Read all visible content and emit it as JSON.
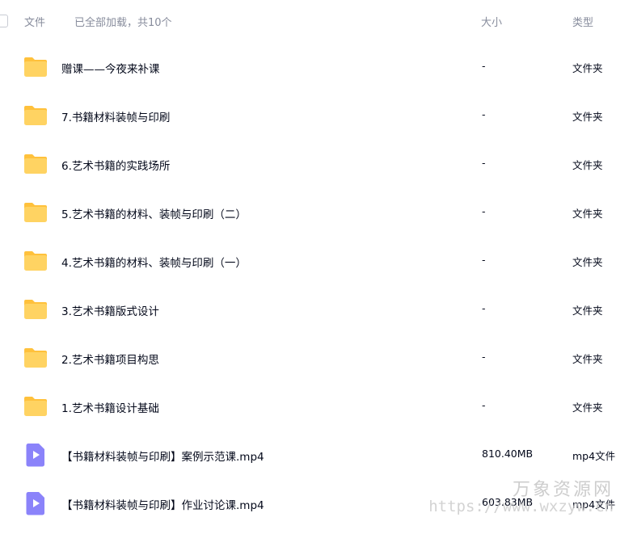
{
  "header": {
    "file_label": "文件",
    "loaded_text": "已全部加载，共10个",
    "size_label": "大小",
    "type_label": "类型"
  },
  "rows": [
    {
      "name": "赠课——今夜来补课",
      "size": "-",
      "type": "文件夹",
      "icon": "folder-icon"
    },
    {
      "name": "7.书籍材料装帧与印刷",
      "size": "-",
      "type": "文件夹",
      "icon": "folder-icon"
    },
    {
      "name": "6.艺术书籍的实践场所",
      "size": "-",
      "type": "文件夹",
      "icon": "folder-icon"
    },
    {
      "name": "5.艺术书籍的材料、装帧与印刷（二）",
      "size": "-",
      "type": "文件夹",
      "icon": "folder-icon"
    },
    {
      "name": "4.艺术书籍的材料、装帧与印刷（一）",
      "size": "-",
      "type": "文件夹",
      "icon": "folder-icon"
    },
    {
      "name": "3.艺术书籍版式设计",
      "size": "-",
      "type": "文件夹",
      "icon": "folder-icon"
    },
    {
      "name": "2.艺术书籍项目构思",
      "size": "-",
      "type": "文件夹",
      "icon": "folder-icon"
    },
    {
      "name": "1.艺术书籍设计基础",
      "size": "-",
      "type": "文件夹",
      "icon": "folder-icon"
    },
    {
      "name": "【书籍材料装帧与印刷】案例示范课.mp4",
      "size": "810.40MB",
      "type": "mp4文件",
      "icon": "video-file-icon"
    },
    {
      "name": "【书籍材料装帧与印刷】作业讨论课.mp4",
      "size": "603.83MB",
      "type": "mp4文件",
      "icon": "video-file-icon"
    }
  ],
  "watermark": {
    "cn": "万象资源网",
    "url": "https://www.wxzyw.cn"
  },
  "colors": {
    "folder_body": "#FFD362",
    "folder_back": "#FFC13C",
    "video_icon": "#8B83FA",
    "text_primary": "#03081A",
    "text_secondary": "#878C9C"
  }
}
